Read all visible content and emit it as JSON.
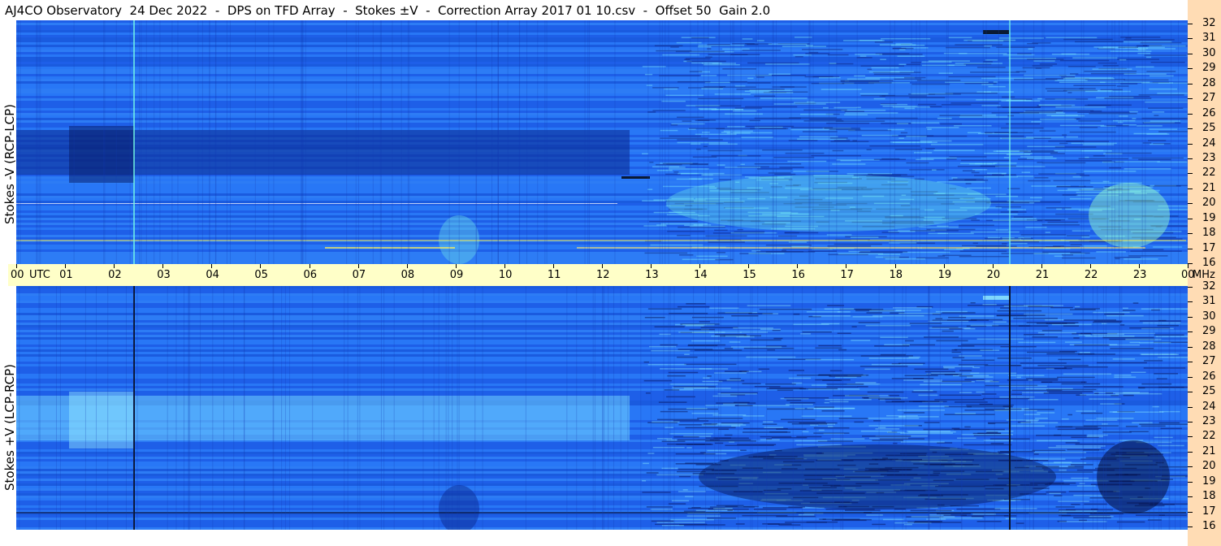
{
  "title": "AJ4CO Observatory  24 Dec 2022  -  DPS on TFD Array  -  Stokes ±V  -  Correction Array 2017 01 10.csv  -  Offset 50  Gain 2.0",
  "panels": {
    "top": {
      "ylabel": "Stokes -V (RCP-LCP)"
    },
    "bottom": {
      "ylabel": "Stokes +V (LCP-RCP)"
    }
  },
  "time_axis": {
    "unit_label": "UTC",
    "ticks": [
      "00",
      "01",
      "02",
      "03",
      "04",
      "05",
      "06",
      "07",
      "08",
      "09",
      "10",
      "11",
      "12",
      "13",
      "14",
      "15",
      "16",
      "17",
      "18",
      "19",
      "20",
      "21",
      "22",
      "23",
      "00"
    ],
    "end_unit": "MHz"
  },
  "freq_axis": {
    "top_ticks": [
      "32",
      "31",
      "30",
      "29",
      "28",
      "27",
      "26",
      "25",
      "24",
      "23",
      "22",
      "21",
      "20",
      "19",
      "18",
      "17",
      "16"
    ],
    "bottom_ticks": [
      "32",
      "31",
      "30",
      "29",
      "28",
      "27",
      "26",
      "25",
      "24",
      "23",
      "22",
      "21",
      "20",
      "19",
      "18",
      "17",
      "16"
    ]
  },
  "colors": {
    "background_blue": "#1f6ff0",
    "time_band": "#ffffc8",
    "freq_strip": "#ffdcb4"
  }
}
